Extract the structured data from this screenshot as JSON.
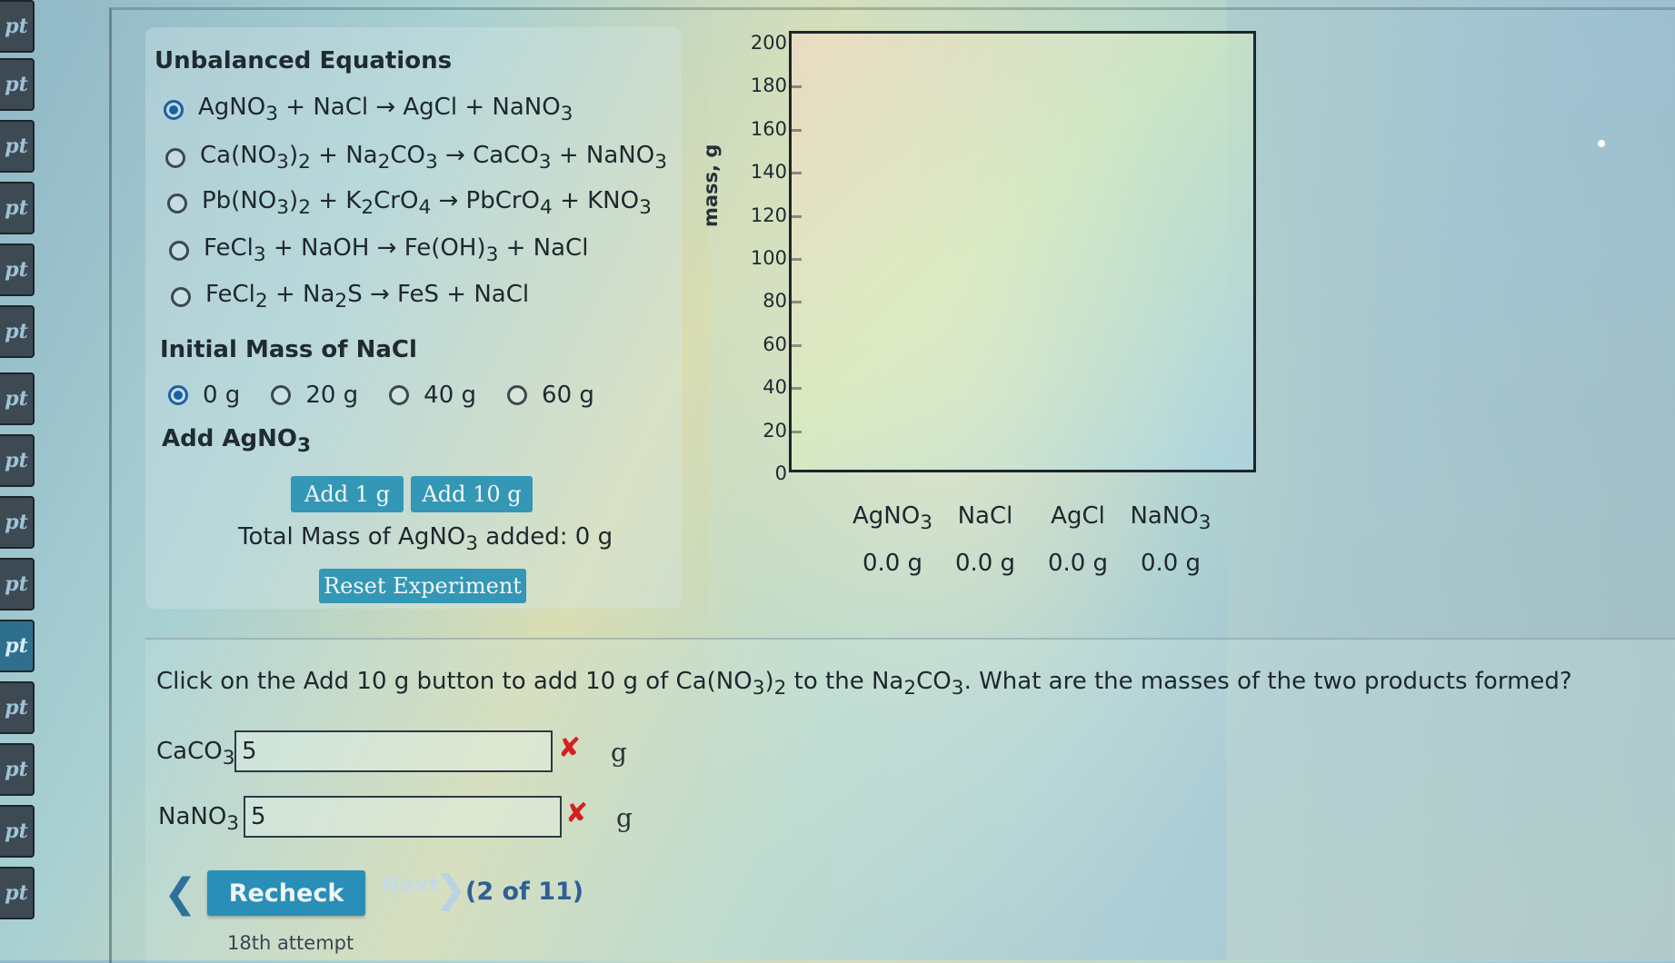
{
  "sidebar": {
    "tabs": [
      "pt",
      "pt",
      "pt",
      "pt",
      "pt",
      "pt",
      "pt",
      "pt",
      "pt",
      "pt",
      "pt",
      "pt",
      "pt",
      "pt",
      "pt"
    ]
  },
  "equations": {
    "heading": "Unbalanced Equations",
    "options": [
      {
        "html": "AgNO<sub>3</sub> + NaCl → AgCl + NaNO<sub>3</sub>",
        "selected": true
      },
      {
        "html": "Ca(NO<sub>3</sub>)<sub>2</sub> + Na<sub>2</sub>CO<sub>3</sub> → CaCO<sub>3</sub> + NaNO<sub>3</sub>",
        "selected": false
      },
      {
        "html": "Pb(NO<sub>3</sub>)<sub>2</sub> + K<sub>2</sub>CrO<sub>4</sub> → PbCrO<sub>4</sub> + KNO<sub>3</sub>",
        "selected": false
      },
      {
        "html": "FeCl<sub>3</sub> + NaOH → Fe(OH)<sub>3</sub> + NaCl",
        "selected": false
      },
      {
        "html": "FeCl<sub>2</sub> + Na<sub>2</sub>S → FeS + NaCl",
        "selected": false
      }
    ]
  },
  "initial_mass": {
    "heading": "Initial Mass of NaCl",
    "options": [
      {
        "label": "0 g",
        "selected": true
      },
      {
        "label": "20 g",
        "selected": false
      },
      {
        "label": "40 g",
        "selected": false
      },
      {
        "label": "60 g",
        "selected": false
      }
    ]
  },
  "add_section": {
    "heading_html": "Add AgNO<sub>3</sub>",
    "add1_label": "Add 1 g",
    "add10_label": "Add 10 g",
    "total_html": "Total Mass of AgNO<sub>3</sub> added: 0 g",
    "reset_label": "Reset Experiment"
  },
  "chart_data": {
    "type": "bar",
    "ylabel": "mass, g",
    "ylim": [
      0,
      200
    ],
    "yticks": [
      0,
      20,
      40,
      60,
      80,
      100,
      120,
      140,
      160,
      180,
      200
    ],
    "categories_html": [
      "AgNO<sub>3</sub>",
      "NaCl",
      "AgCl",
      "NaNO<sub>3</sub>"
    ],
    "values": [
      0.0,
      0.0,
      0.0,
      0.0
    ],
    "value_labels": [
      "0.0 g",
      "0.0 g",
      "0.0 g",
      "0.0 g"
    ],
    "grid": false
  },
  "question": {
    "text_html": "Click on the Add 10 g button to add 10 g of Ca(NO<sub>3</sub>)<sub>2</sub> to the Na<sub>2</sub>CO<sub>3</sub>. What are the masses of the two products formed?",
    "answers": [
      {
        "label_html": "CaCO<sub>3</sub>",
        "value": "5",
        "unit": "g",
        "mark": "✘"
      },
      {
        "label_html": "NaNO<sub>3</sub>",
        "value": "5",
        "unit": "g",
        "mark": "✘"
      }
    ]
  },
  "nav": {
    "recheck_label": "Recheck",
    "next_label": "Next",
    "progress": "(2 of 11)",
    "attempt": "18th attempt"
  }
}
